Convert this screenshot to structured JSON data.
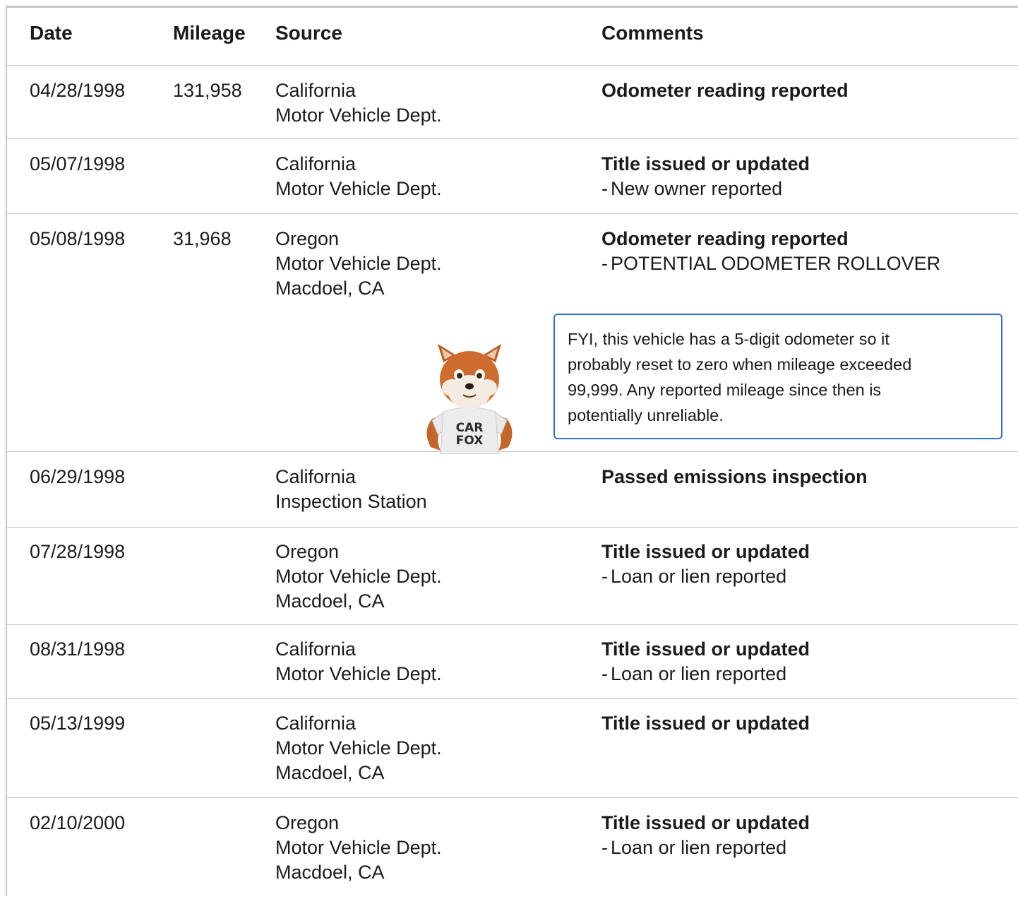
{
  "table": {
    "headers": {
      "date": "Date",
      "mileage": "Mileage",
      "source": "Source",
      "comments": "Comments"
    },
    "rows": [
      {
        "date": "04/28/1998",
        "mileage": "131,958",
        "source": [
          "California",
          "Motor Vehicle Dept."
        ],
        "comment": "Odometer reading reported",
        "detail": ""
      },
      {
        "date": "05/07/1998",
        "mileage": "",
        "source": [
          "California",
          "Motor Vehicle Dept."
        ],
        "comment": "Title issued or updated",
        "detail": "New owner reported"
      },
      {
        "date": "05/08/1998",
        "mileage": "31,968",
        "source": [
          "Oregon",
          "Motor Vehicle Dept.",
          "Macdoel, CA"
        ],
        "comment": "Odometer reading reported",
        "detail": "POTENTIAL ODOMETER ROLLOVER"
      },
      {
        "date": "06/29/1998",
        "mileage": "",
        "source": [
          "California",
          "Inspection Station"
        ],
        "comment": "Passed emissions inspection",
        "detail": ""
      },
      {
        "date": "07/28/1998",
        "mileage": "",
        "source": [
          "Oregon",
          "Motor Vehicle Dept.",
          "Macdoel, CA"
        ],
        "comment": "Title issued or updated",
        "detail": "Loan or lien reported"
      },
      {
        "date": "08/31/1998",
        "mileage": "",
        "source": [
          "California",
          "Motor Vehicle Dept."
        ],
        "comment": "Title issued or updated",
        "detail": "Loan or lien reported"
      },
      {
        "date": "05/13/1999",
        "mileage": "",
        "source": [
          "California",
          "Motor Vehicle Dept.",
          "Macdoel, CA"
        ],
        "comment": "Title issued or updated",
        "detail": ""
      },
      {
        "date": "02/10/2000",
        "mileage": "",
        "source": [
          "Oregon",
          "Motor Vehicle Dept.",
          "Macdoel, CA"
        ],
        "comment": "Title issued or updated",
        "detail": "Loan or lien reported"
      }
    ]
  },
  "callout": {
    "lines": [
      "FYI, this vehicle has a 5-digit odometer so it",
      "probably reset to zero when mileage exceeded",
      "99,999. Any reported mileage since then is",
      "potentially unreliable."
    ]
  },
  "mascot": {
    "shirt_line1": "CAR",
    "shirt_line2": "FOX",
    "icon": "carfox-mascot-icon"
  },
  "colors": {
    "border": "#c4c4c4",
    "callout_border": "#2f72c9",
    "text": "#1b1b1b"
  }
}
